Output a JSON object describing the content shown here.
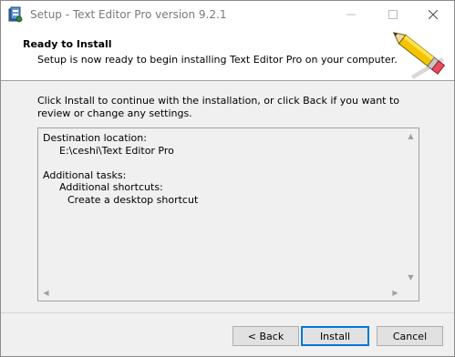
{
  "window": {
    "title": "Setup - Text Editor Pro version 9.2.1",
    "app_icon": "setup-installer-icon",
    "controls": {
      "minimize": "–",
      "maximize": "☐",
      "close": "✕"
    }
  },
  "header": {
    "title": "Ready to Install",
    "subtitle": "Setup is now ready to begin installing Text Editor Pro on your computer.",
    "icon": "pencil-icon"
  },
  "body": {
    "intro": "Click Install to continue with the installation, or click Back if you want to review or change any settings."
  },
  "summary": {
    "destination_label": "Destination location:",
    "destination_value": "E:\\ceshi\\Text Editor Pro",
    "tasks_label": "Additional tasks:",
    "shortcuts_label": "Additional shortcuts:",
    "shortcut_item": "Create a desktop shortcut"
  },
  "buttons": {
    "back": "< Back",
    "install": "Install",
    "cancel": "Cancel"
  },
  "colors": {
    "accent": "#0078d7",
    "dialog_bg": "#f0f0f0",
    "header_bg": "#ffffff"
  }
}
